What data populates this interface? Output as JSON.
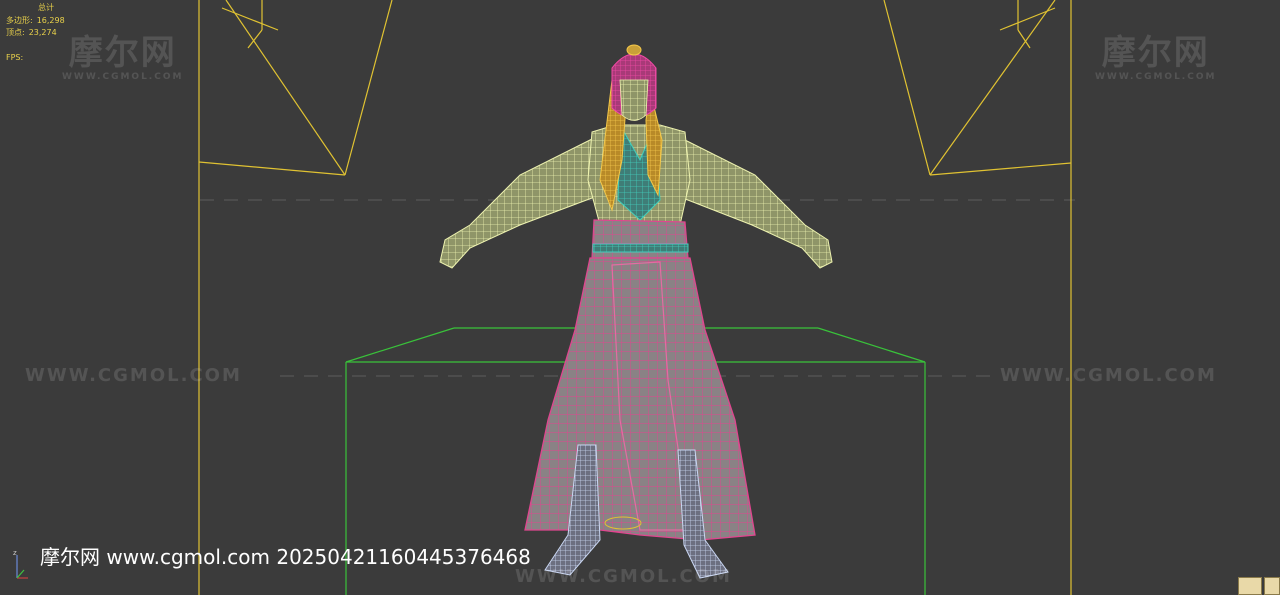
{
  "stats": {
    "header": "总计",
    "polys_label": "多边形:",
    "polys_value": "16,298",
    "verts_label": "顶点:",
    "verts_value": "23,274",
    "fps_label": "FPS:"
  },
  "watermarks": {
    "logo_cn": "摩尔网",
    "logo_en": "WWW.CGMOL.COM",
    "url": "WWW.CGMOL.COM"
  },
  "caption": "摩尔网 www.cgmol.com 20250421160445376468",
  "colors": {
    "background": "#3b3b3b",
    "frame_lines": "#e0c232",
    "bounding_box": "#39c23a",
    "wire_body": "#ddeaa0",
    "wire_robe": "#d63a86",
    "wire_teal": "#2fb8a8",
    "wire_hair": "#e8b83a"
  },
  "icons": {
    "axis": "xyz-axis-icon",
    "nav_1": "viewcube-home-icon",
    "nav_2": "viewcube-icon"
  }
}
